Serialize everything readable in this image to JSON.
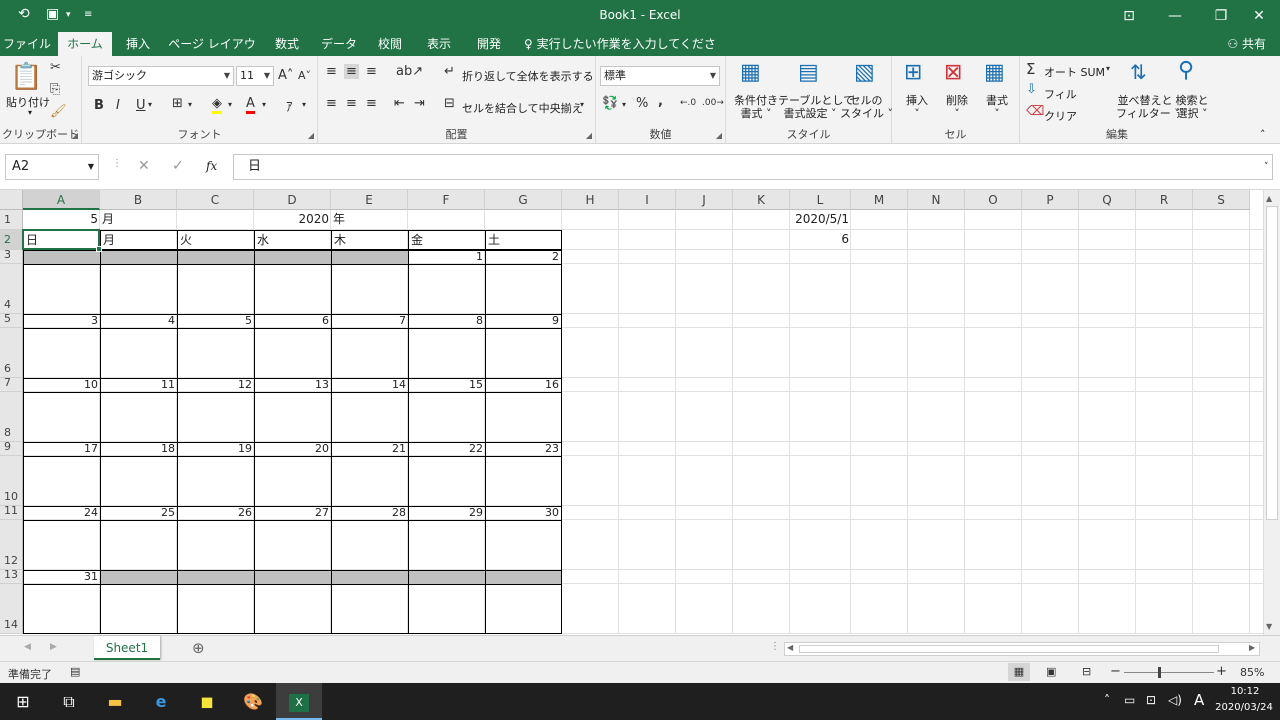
{
  "titlebar": {
    "title": "Book1  -  Excel",
    "qa_autosave_icon": "save-icon",
    "qa_touch_icon": "touch-mode-icon"
  },
  "tabs": [
    "ファイル",
    "ホーム",
    "挿入",
    "ページ レイアウト",
    "数式",
    "データ",
    "校閲",
    "表示",
    "開発"
  ],
  "active_tab": "ホーム",
  "tellme": "実行したい作業を入力してください...",
  "share": "共有",
  "ribbon": {
    "clipboard": {
      "paste": "貼り付け",
      "label": "クリップボード"
    },
    "font": {
      "name": "游ゴシック",
      "size": "11",
      "label": "フォント",
      "bold": "B",
      "italic": "I",
      "underline": "U"
    },
    "align": {
      "wrap": "折り返して全体を表示する",
      "merge": "セルを結合して中央揃え",
      "label": "配置"
    },
    "number": {
      "format": "標準",
      "percent": "%",
      "comma": ",",
      "label": "数値"
    },
    "styles": {
      "cond1": "条件付き",
      "cond2": "書式 ˅",
      "table1": "テーブルとして",
      "table2": "書式設定 ˅",
      "cell1": "セルの",
      "cell2": "スタイル ˅",
      "label": "スタイル"
    },
    "cells": {
      "insert": "挿入",
      "delete": "削除",
      "format": "書式",
      "label": "セル"
    },
    "edit": {
      "autosum": "オート SUM",
      "fill": "フィル",
      "clear": "クリア",
      "sort1": "並べ替えと",
      "sort2": "フィルター ˅",
      "find1": "検索と",
      "find2": "選択 ˅",
      "label": "編集"
    }
  },
  "formula_bar": {
    "name_box": "A2",
    "cancel": "✕",
    "enter": "✓",
    "fx": "fx",
    "value": "日"
  },
  "columns": [
    "A",
    "B",
    "C",
    "D",
    "E",
    "F",
    "G",
    "H",
    "I",
    "J",
    "K",
    "L",
    "M",
    "N",
    "O",
    "P",
    "Q",
    "R",
    "S"
  ],
  "rows": [
    "1",
    "2",
    "3",
    "4",
    "5",
    "6",
    "7",
    "8",
    "9",
    "10",
    "11",
    "12",
    "13",
    "14"
  ],
  "cells": {
    "A1": "5",
    "B1": "月",
    "D1": "2020",
    "E1": "年",
    "L1": "2020/5/1",
    "L2": "6",
    "headers": [
      "日",
      "月",
      "火",
      "水",
      "木",
      "金",
      "土"
    ],
    "weeks": [
      [
        "",
        "",
        "",
        "",
        "",
        "1",
        "2"
      ],
      [
        "3",
        "4",
        "5",
        "6",
        "7",
        "8",
        "9"
      ],
      [
        "10",
        "11",
        "12",
        "13",
        "14",
        "15",
        "16"
      ],
      [
        "17",
        "18",
        "19",
        "20",
        "21",
        "22",
        "23"
      ],
      [
        "24",
        "25",
        "26",
        "27",
        "28",
        "29",
        "30"
      ],
      [
        "31",
        "",
        "",
        "",
        "",
        "",
        ""
      ]
    ]
  },
  "sheet_tab": "Sheet1",
  "status": {
    "ready": "準備完了",
    "zoom": "85%"
  },
  "taskbar": {
    "time": "10:12",
    "date": "2020/03/24",
    "ime": "A"
  }
}
